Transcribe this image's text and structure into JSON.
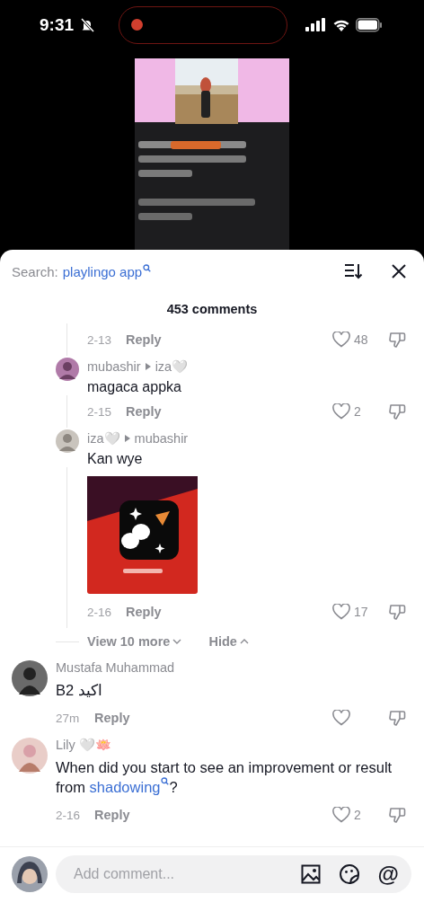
{
  "status_bar": {
    "time": "9:31",
    "recording": true
  },
  "search": {
    "label": "Search:",
    "query": "playlingo app"
  },
  "comment_count": "453 comments",
  "replies": [
    {
      "kind": "footer_only",
      "date": "2-13",
      "reply": "Reply",
      "likes": "48"
    },
    {
      "kind": "reply",
      "author": "mubashir",
      "reply_to": "iza🤍",
      "text": "magaca appka",
      "date": "2-15",
      "reply": "Reply",
      "likes": "2"
    },
    {
      "kind": "reply",
      "author": "iza🤍",
      "reply_to": "mubashir",
      "text": "Kan wye",
      "date": "2-16",
      "reply": "Reply",
      "likes": "17"
    }
  ],
  "replies_controls": {
    "view_more": "View 10 more",
    "hide": "Hide"
  },
  "comments": [
    {
      "author": "Mustafa Muhammad",
      "parts": [
        {
          "kind": "plain",
          "text": "B2 اكيد"
        }
      ],
      "date": "27m",
      "reply": "Reply"
    },
    {
      "author": "Lily 🤍🪷",
      "parts": [
        {
          "kind": "plain",
          "text": "When did you start to see an improvement or result from "
        },
        {
          "kind": "link",
          "text": "shadowing"
        },
        {
          "kind": "plain",
          "text": "?"
        }
      ],
      "date": "2-16",
      "reply": "Reply",
      "likes": "2"
    }
  ],
  "composer": {
    "placeholder": "Add comment...",
    "mention": "@"
  }
}
